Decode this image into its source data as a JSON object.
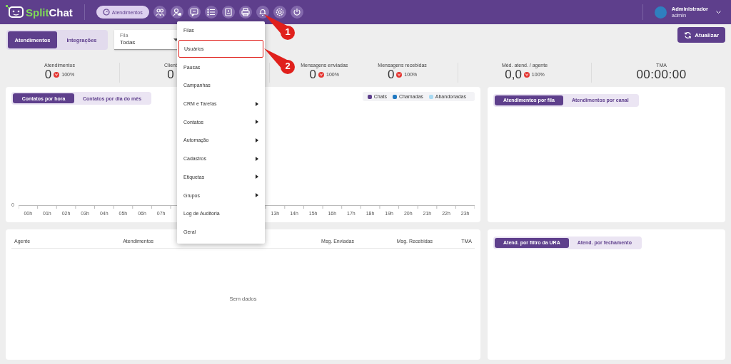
{
  "header": {
    "logo": {
      "part_1": "Split",
      "part_2": "Chat"
    },
    "nav": [
      {
        "label": "Atendimentos",
        "selected": true
      },
      {
        "selected": false
      },
      {
        "selected": false
      },
      {
        "selected": false
      },
      {
        "selected": false
      },
      {
        "selected": false
      },
      {
        "selected": false
      },
      {
        "selected": false
      },
      {
        "selected": false
      },
      {
        "selected": false
      }
    ],
    "user": {
      "name": "Administrador",
      "login": "admin"
    }
  },
  "toolbar": {
    "tabs": [
      {
        "label": "Atendimentos",
        "selected": true
      },
      {
        "label": "Integrações",
        "selected": false
      }
    ],
    "filter": {
      "label": "Fila",
      "value": "Todas"
    },
    "refresh_button": "Atualizar"
  },
  "stats": [
    {
      "label": "Atendimentos",
      "value": "0",
      "change": "100%"
    },
    {
      "label": "Client",
      "value": "0"
    },
    {
      "label": "Mensagens enviadas",
      "value": "0",
      "change": "100%"
    },
    {
      "label": "Mensagens recebidas",
      "value": "0",
      "change": "100%"
    },
    {
      "label": "Méd. atend. / agente",
      "value": "0,0",
      "change": "100%"
    },
    {
      "label": "TMA",
      "value": "00:00:00"
    }
  ],
  "hourly_panel": {
    "tabs": [
      {
        "label": "Contatos por hora",
        "selected": true
      },
      {
        "label": "Contatos por dia do mês",
        "selected": false
      }
    ],
    "legend": [
      {
        "label": "Chats",
        "color": "#5e3f8c"
      },
      {
        "label": "Chamadas",
        "color": "#1f78c1"
      },
      {
        "label": "Abandonadas",
        "color": "#a9daf2"
      }
    ],
    "y_tick": "0",
    "x_labels_left": [
      "00h",
      "01h",
      "02h",
      "03h",
      "04h",
      "05h",
      "06h",
      "07h"
    ],
    "x_labels_right": [
      "13h",
      "14h",
      "15h",
      "16h",
      "17h",
      "18h",
      "19h",
      "20h",
      "21h",
      "22h",
      "23h"
    ]
  },
  "queue_panel": {
    "tabs": [
      {
        "label": "Atendimentos por fila",
        "selected": true
      },
      {
        "label": "Atendimentos por canal",
        "selected": false
      }
    ]
  },
  "agents_table": {
    "columns": [
      "Agente",
      "Atendimentos",
      "Msg. Enviadas",
      "Msg. Recebidas",
      "TMA"
    ],
    "empty_text": "Sem dados"
  },
  "ivr_panel": {
    "tabs": [
      {
        "label": "Atend. por filtro da URA",
        "selected": true
      },
      {
        "label": "Atend. por fechamento",
        "selected": false
      }
    ]
  },
  "settings_menu": {
    "items": [
      {
        "label": "Filas",
        "submenu": false,
        "selected": false
      },
      {
        "label": "Usuários",
        "submenu": false,
        "selected": true
      },
      {
        "label": "Pausas",
        "submenu": false,
        "selected": false
      },
      {
        "label": "Campanhas",
        "submenu": false,
        "selected": false
      },
      {
        "label": "CRM e Tarefas",
        "submenu": true,
        "selected": false
      },
      {
        "label": "Contatos",
        "submenu": true,
        "selected": false
      },
      {
        "label": "Automação",
        "submenu": true,
        "selected": false
      },
      {
        "label": "Cadastros",
        "submenu": true,
        "selected": false
      },
      {
        "label": "Etiquetas",
        "submenu": true,
        "selected": false
      },
      {
        "label": "Grupos",
        "submenu": true,
        "selected": false
      },
      {
        "label": "Log de Auditoria",
        "submenu": false,
        "selected": false
      },
      {
        "label": "Geral",
        "submenu": false,
        "selected": false
      }
    ]
  },
  "callouts": [
    {
      "label": "1"
    },
    {
      "label": "2"
    }
  ]
}
